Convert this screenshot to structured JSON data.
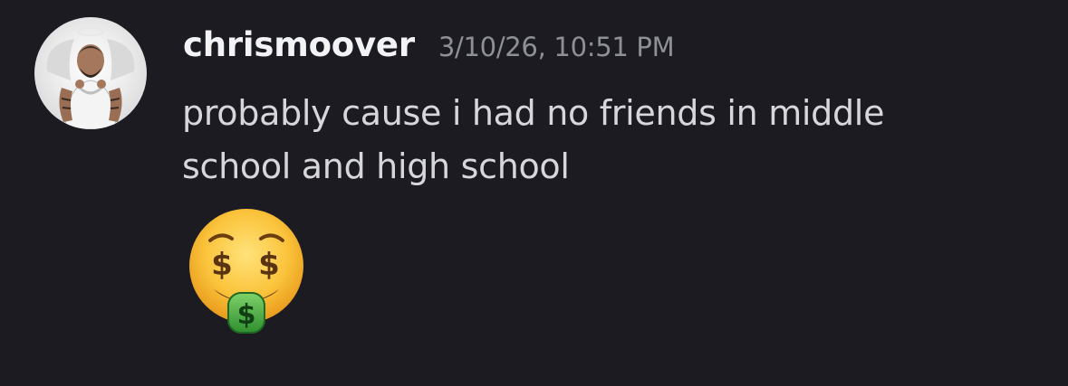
{
  "message": {
    "username": "chrismoover",
    "timestamp": "3/10/26, 10:51 PM",
    "text": "probably cause i had no friends in middle school and high school",
    "avatar_icon": "user-avatar-photo",
    "emoji": "money-mouth-face"
  },
  "colors": {
    "background": "#1c1b21",
    "username": "#f2f3f5",
    "timestamp": "#8e9097",
    "message_text": "#d6d7da"
  }
}
